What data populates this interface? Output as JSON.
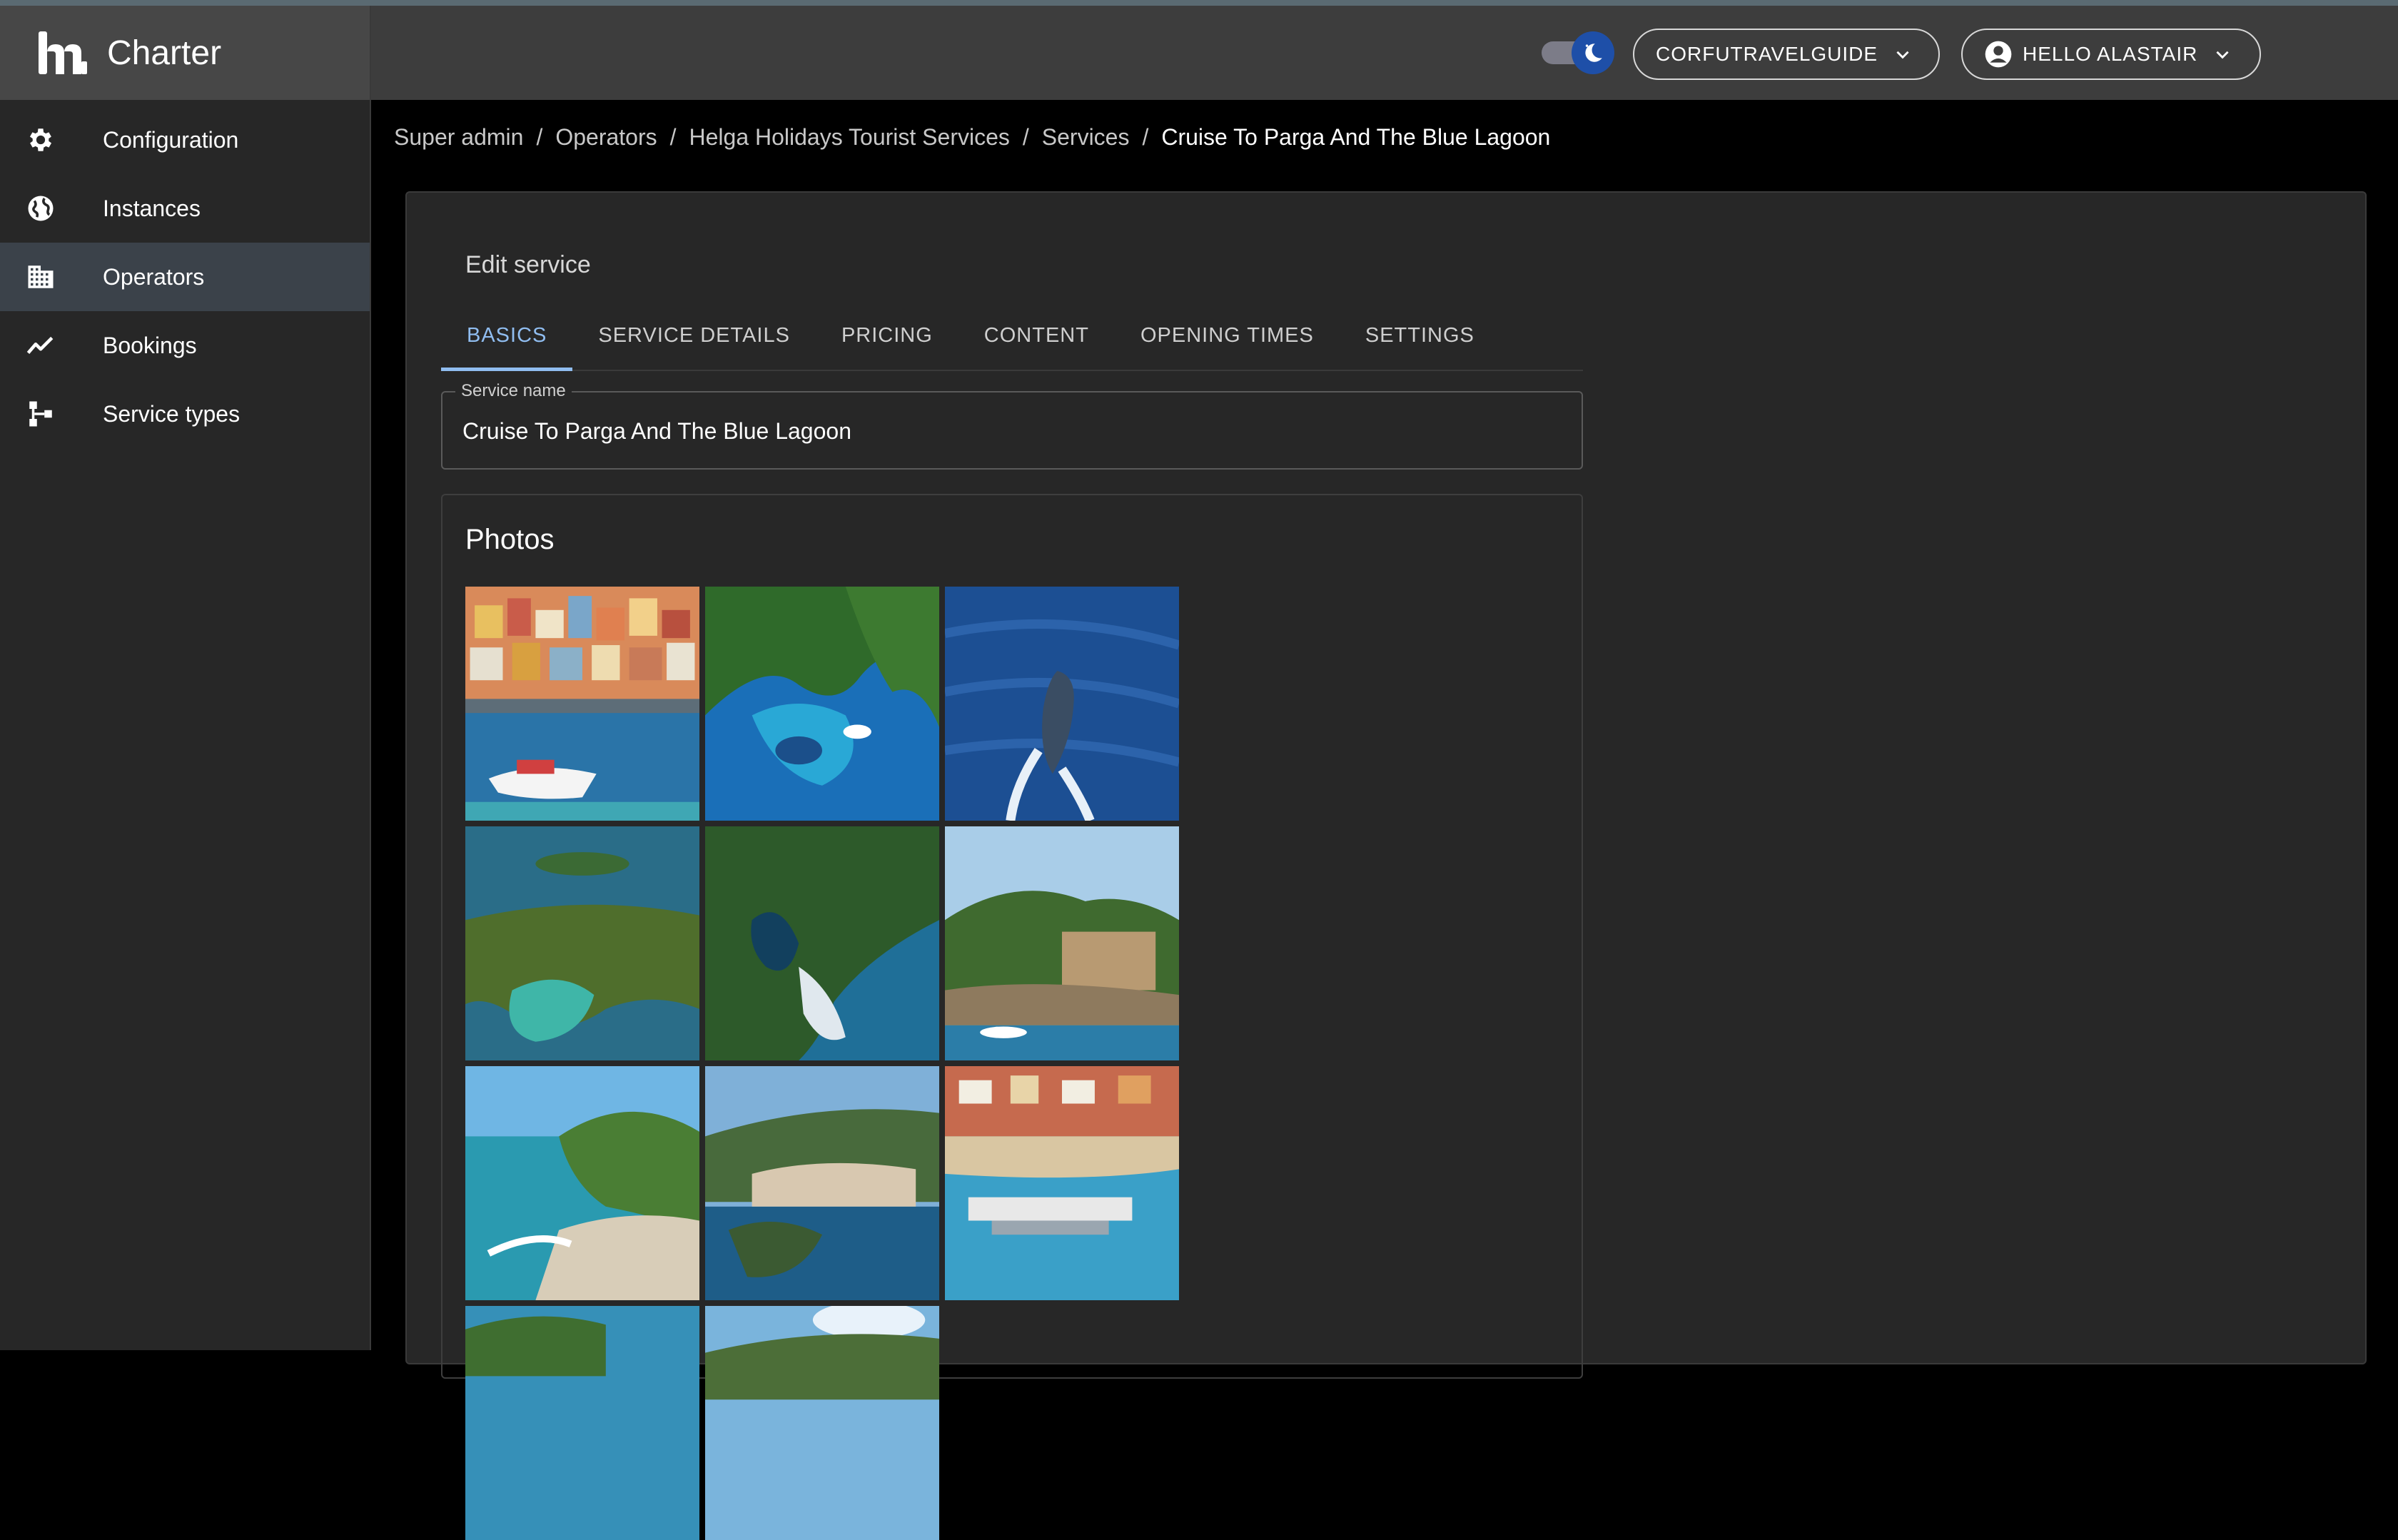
{
  "app": {
    "name": "Charter"
  },
  "sidebar": {
    "items": [
      {
        "label": "Configuration",
        "icon": "gear-icon"
      },
      {
        "label": "Instances",
        "icon": "globe-icon"
      },
      {
        "label": "Operators",
        "icon": "building-icon",
        "active": true
      },
      {
        "label": "Bookings",
        "icon": "trend-icon"
      },
      {
        "label": "Service types",
        "icon": "hierarchy-icon"
      }
    ]
  },
  "header": {
    "theme_toggle": {
      "mode": "dark",
      "icon": "moon-icon"
    },
    "instance_selector": "CORFUTRAVELGUIDE",
    "user_menu": "HELLO ALASTAIR"
  },
  "breadcrumb": {
    "items": [
      "Super admin",
      "Operators",
      "Helga Holidays Tourist Services",
      "Services"
    ],
    "current": "Cruise To Parga And The Blue Lagoon"
  },
  "editor": {
    "title": "Edit service",
    "tabs": [
      "BASICS",
      "SERVICE DETAILS",
      "PRICING",
      "CONTENT",
      "OPENING TIMES",
      "SETTINGS"
    ],
    "active_tab": "BASICS",
    "service_name": {
      "label": "Service name",
      "value": "Cruise To Parga And The Blue Lagoon"
    },
    "photos": {
      "title": "Photos",
      "count_visible": 11
    }
  },
  "colors": {
    "accent": "#90bdf0",
    "sidebar_bg": "#272727",
    "header_bg": "#3d3d3d",
    "active_nav_bg": "#3b424a",
    "toggle_thumb": "#1e4fa8"
  }
}
